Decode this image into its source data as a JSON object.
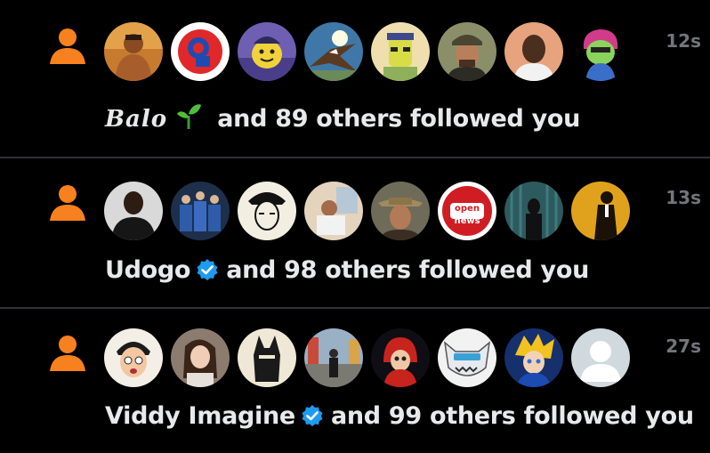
{
  "notifications": [
    {
      "name": "Balo",
      "verified": false,
      "rest": "and 89 others followed you",
      "time": "12s"
    },
    {
      "name": "Udogo",
      "verified": true,
      "rest": "and 98 others followed you",
      "time": "13s"
    },
    {
      "name": "Viddy Imagine",
      "verified": true,
      "rest": "and 99 others followed you",
      "time": "27s"
    }
  ],
  "avatar_labels": {
    "open_news": [
      "open",
      "news"
    ]
  },
  "colors": {
    "background": "#000000",
    "accent_orange": "#f7811e",
    "verified_blue": "#1d9bf0",
    "time_gray": "#71767b",
    "text": "#e7e9ea",
    "divider": "#2f3336"
  },
  "icons": {
    "notification_type": "person-icon",
    "verified": "verified-badge-icon",
    "sprout": "sprout-emoji-icon"
  }
}
